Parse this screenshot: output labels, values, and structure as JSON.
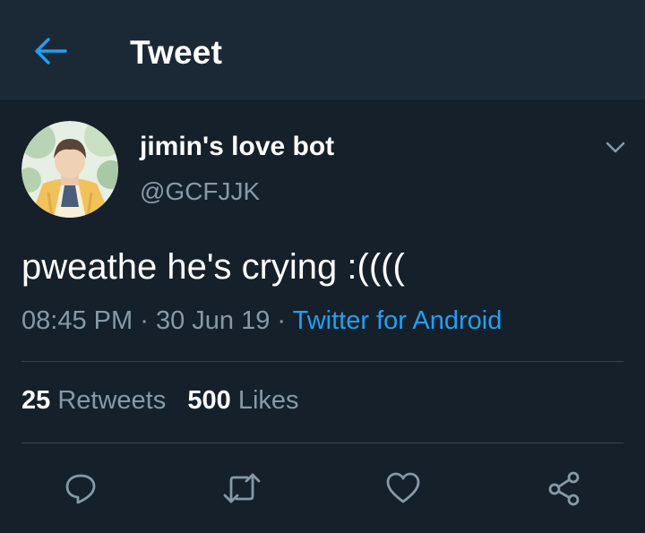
{
  "header": {
    "title": "Tweet",
    "back_icon": "arrow-left-icon"
  },
  "tweet": {
    "display_name": "jimin's love bot",
    "handle": "@GCFJJK",
    "text": "pweathe he's crying :((((",
    "time": "08:45 PM",
    "date": "30 Jun 19",
    "separator": "·",
    "source": "Twitter for Android"
  },
  "stats": {
    "retweets_count": "25",
    "retweets_label": "Retweets",
    "likes_count": "500",
    "likes_label": "Likes"
  },
  "actions": [
    "reply-icon",
    "retweet-icon",
    "like-icon",
    "share-icon"
  ],
  "colors": {
    "background": "#15202b",
    "header": "#1b2836",
    "accent": "#1da1f2",
    "secondary_text": "#8899a6",
    "divider": "#38444d"
  }
}
